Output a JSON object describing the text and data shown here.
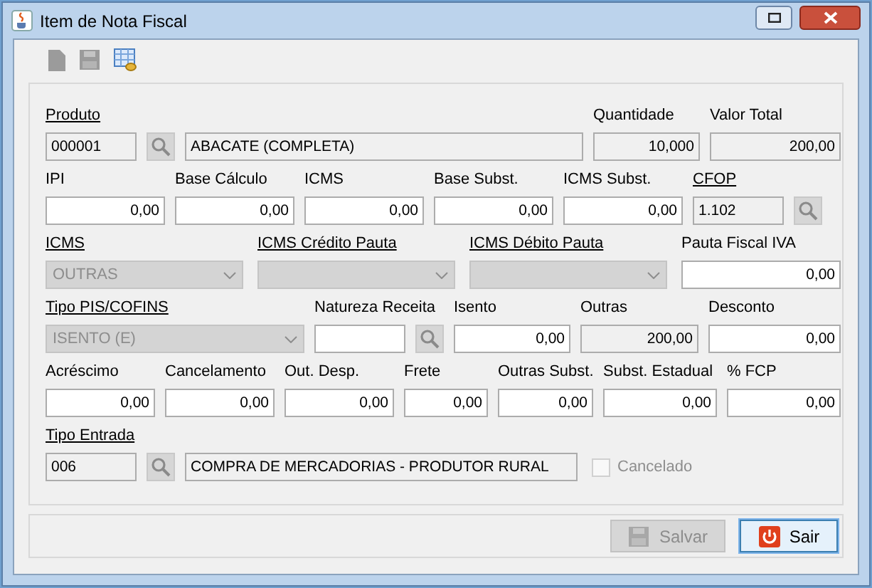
{
  "window": {
    "title": "Item de Nota Fiscal"
  },
  "rows": [
    {
      "fields": [
        {
          "kind": "text",
          "label": "Produto",
          "underlined": true,
          "value": "000001",
          "readonly": true
        },
        {
          "kind": "lookup",
          "disabled": true
        },
        {
          "kind": "text",
          "value": "ABACATE (COMPLETA)",
          "readonly": true
        },
        {
          "kind": "number",
          "label": "Quantidade",
          "underlined": false,
          "value": "10,000",
          "readonly": true
        },
        {
          "kind": "number",
          "label": "Valor Total",
          "underlined": false,
          "value": "200,00",
          "readonly": true
        }
      ]
    },
    {
      "fields": [
        {
          "kind": "number",
          "label": "IPI",
          "underlined": false,
          "value": "0,00",
          "readonly": false
        },
        {
          "kind": "number",
          "label": "Base Cálculo",
          "underlined": false,
          "value": "0,00",
          "readonly": false
        },
        {
          "kind": "number",
          "label": "ICMS",
          "underlined": false,
          "value": "0,00",
          "readonly": false
        },
        {
          "kind": "number",
          "label": "Base Subst.",
          "underlined": false,
          "value": "0,00",
          "readonly": false
        },
        {
          "kind": "number",
          "label": "ICMS Subst.",
          "underlined": false,
          "value": "0,00",
          "readonly": false
        },
        {
          "kind": "text",
          "label": "CFOP",
          "underlined": true,
          "value": "1.102",
          "readonly": true
        },
        {
          "kind": "lookup",
          "disabled": true
        }
      ]
    },
    {
      "fields": [
        {
          "kind": "combo",
          "label": "ICMS",
          "underlined": true,
          "value": "OUTRAS",
          "disabled": true
        },
        {
          "kind": "combo",
          "label": "ICMS Crédito Pauta",
          "underlined": true,
          "disabled": true
        },
        {
          "kind": "combo",
          "label": "ICMS Débito Pauta",
          "underlined": true,
          "disabled": true
        },
        {
          "kind": "number",
          "label": "Pauta Fiscal IVA",
          "underlined": false,
          "value": "0,00",
          "readonly": false
        }
      ]
    },
    {
      "fields": [
        {
          "kind": "combo",
          "label": "Tipo PIS/COFINS",
          "underlined": true,
          "value": "ISENTO (E)",
          "disabled": true
        },
        {
          "kind": "text",
          "label": "Natureza Receita",
          "underlined": false,
          "readonly": false
        },
        {
          "kind": "lookup",
          "disabled": true
        },
        {
          "kind": "number",
          "label": "Isento",
          "underlined": false,
          "value": "0,00",
          "readonly": false
        },
        {
          "kind": "number",
          "label": "Outras",
          "underlined": false,
          "value": "200,00",
          "readonly": true
        },
        {
          "kind": "number",
          "label": "Desconto",
          "underlined": false,
          "value": "0,00",
          "readonly": false
        }
      ]
    },
    {
      "fields": [
        {
          "kind": "number",
          "label": "Acréscimo",
          "underlined": false,
          "value": "0,00",
          "readonly": false
        },
        {
          "kind": "number",
          "label": "Cancelamento",
          "underlined": false,
          "value": "0,00",
          "readonly": false
        },
        {
          "kind": "number",
          "label": "Out. Desp.",
          "underlined": false,
          "value": "0,00",
          "readonly": false
        },
        {
          "kind": "number",
          "label": "Frete",
          "underlined": false,
          "value": "0,00",
          "readonly": false
        },
        {
          "kind": "number",
          "label": "Outras Subst.",
          "underlined": false,
          "value": "0,00",
          "readonly": false
        },
        {
          "kind": "number",
          "label": "Subst. Estadual",
          "underlined": false,
          "value": "0,00",
          "readonly": false
        },
        {
          "kind": "number",
          "label": "% FCP",
          "underlined": false,
          "value": "0,00",
          "readonly": false
        }
      ]
    },
    {
      "fields": [
        {
          "kind": "text",
          "label": "Tipo Entrada",
          "underlined": true,
          "value": "006",
          "readonly": true
        },
        {
          "kind": "lookup",
          "disabled": true
        },
        {
          "kind": "text",
          "value": "COMPRA DE MERCADORIAS - PRODUTOR RURAL",
          "readonly": true
        },
        {
          "kind": "checkbox",
          "text": "Cancelado",
          "checked": false,
          "disabled": true
        }
      ]
    }
  ],
  "buttons": [
    {
      "kind": "save",
      "label": "Salvar",
      "disabled": true
    },
    {
      "kind": "exit",
      "label": "Sair",
      "disabled": false
    }
  ]
}
